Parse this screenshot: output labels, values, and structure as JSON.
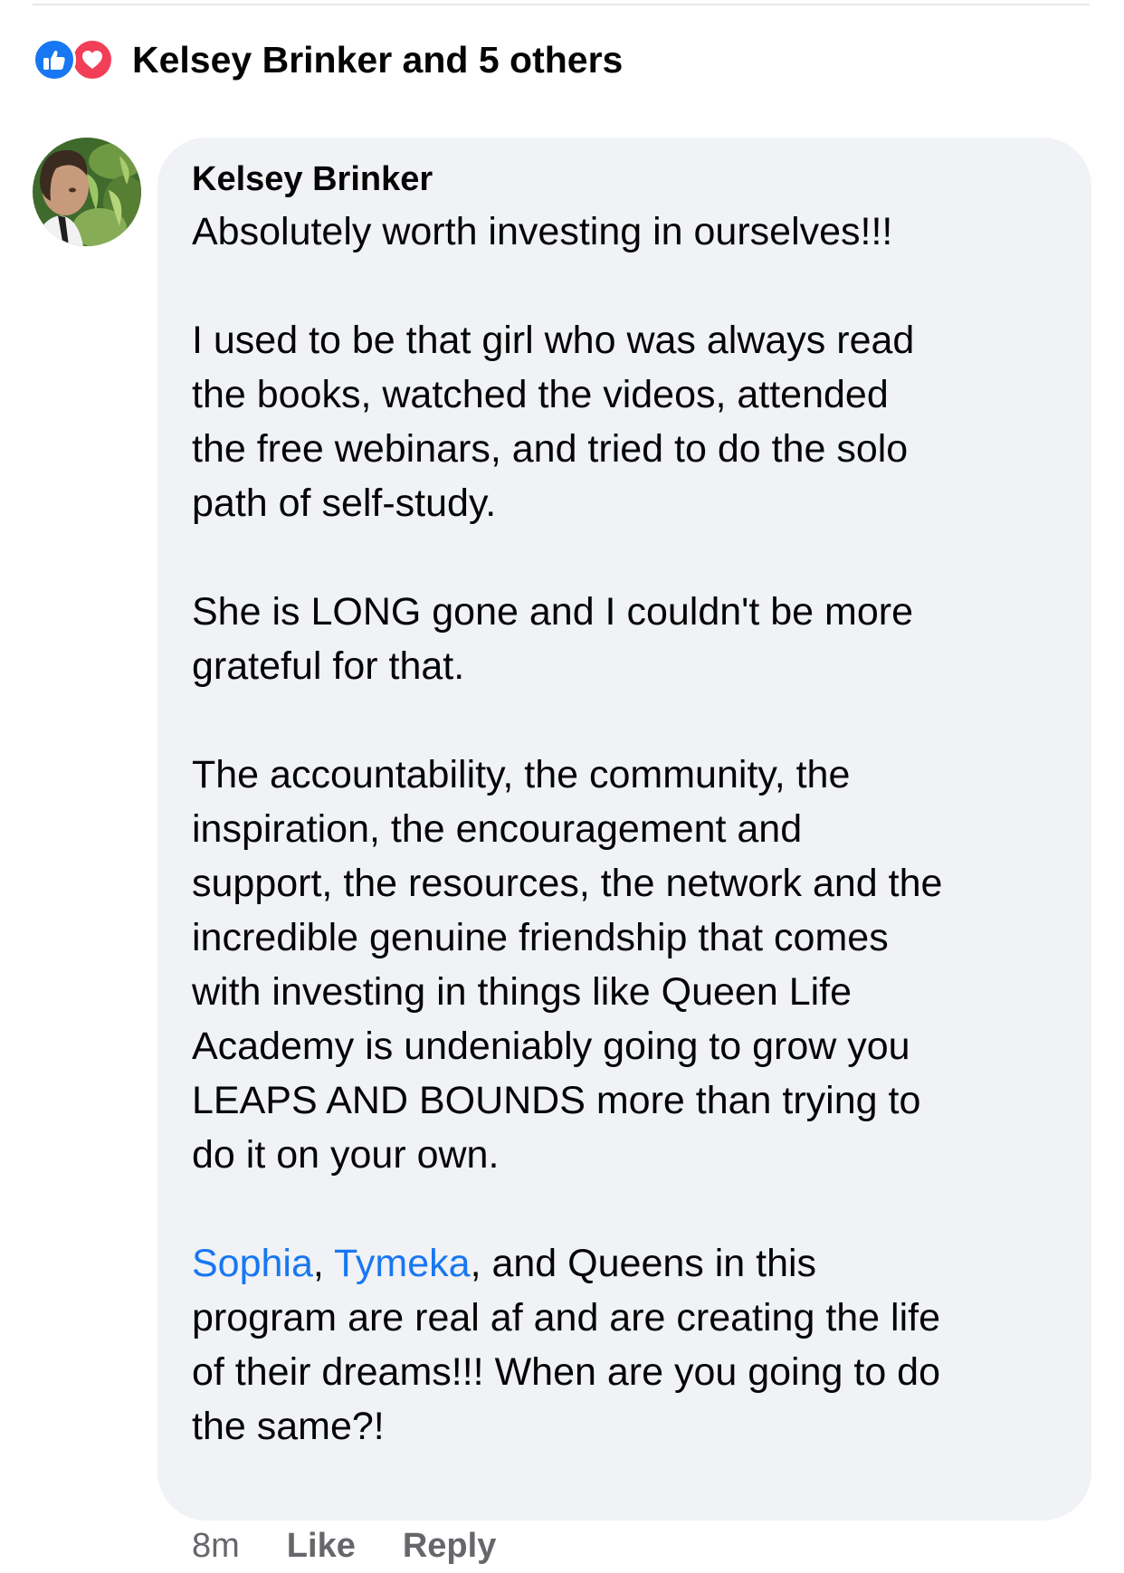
{
  "reactions": {
    "icons": [
      "like-icon",
      "love-icon"
    ],
    "summary": "Kelsey Brinker and 5 others"
  },
  "comment": {
    "author": "Kelsey Brinker",
    "body": {
      "p1": "Absolutely worth investing in ourselves!!!",
      "p2": [
        "I used to be that girl who was always read",
        "the books, watched the videos, attended",
        "the free webinars, and tried to do the solo",
        "path of self-study."
      ],
      "p3": [
        "She is LONG gone and I couldn't be more",
        "grateful for that."
      ],
      "p4": [
        "The accountability, the community, the",
        "inspiration, the encouragement and",
        "support, the resources, the network and the",
        "incredible genuine friendship that comes",
        "with investing in things like Queen Life",
        "Academy is undeniably going to grow you",
        "LEAPS AND BOUNDS more than trying to",
        "do it on your own."
      ],
      "p5": {
        "mention1": "Sophia",
        "sep1": ", ",
        "mention2": "Tymeka",
        "line1_rest": ", and Queens in this",
        "lines": [
          "program are real af and are creating the life",
          "of their dreams!!! When are you going to do",
          "the same?!"
        ]
      }
    },
    "timestamp": "8m",
    "like_label": "Like",
    "reply_label": "Reply"
  },
  "colors": {
    "like_blue": "#1877f2",
    "love_red": "#f33e58",
    "bubble_bg": "#f0f2f5",
    "mention": "#1877f2",
    "meta_text": "#65676b"
  }
}
